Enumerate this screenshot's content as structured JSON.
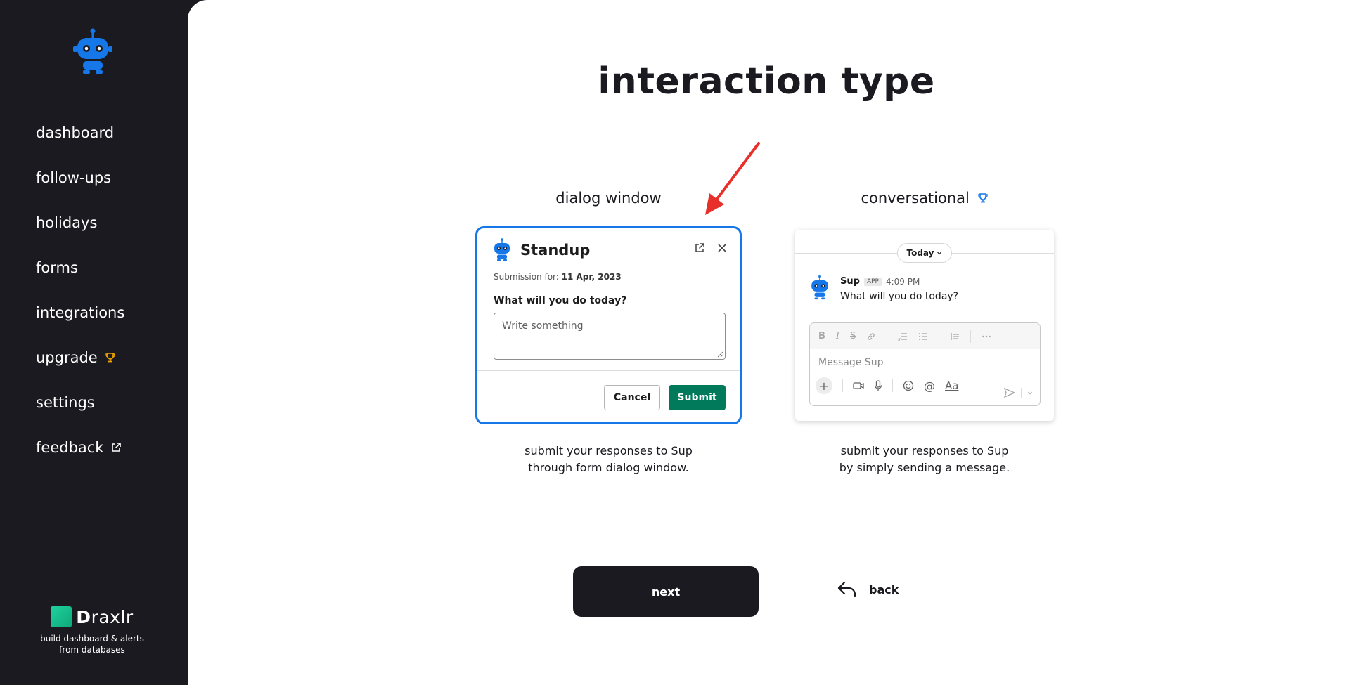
{
  "sidebar": {
    "items": [
      {
        "label": "dashboard"
      },
      {
        "label": "follow-ups"
      },
      {
        "label": "holidays"
      },
      {
        "label": "forms"
      },
      {
        "label": "integrations"
      },
      {
        "label": "upgrade"
      },
      {
        "label": "settings"
      },
      {
        "label": "feedback"
      }
    ],
    "brand": {
      "name_initial": "D",
      "name_rest": "raxlr",
      "tagline_line1": "build dashboard & alerts",
      "tagline_line2": "from databases"
    }
  },
  "main": {
    "title": "interaction type",
    "options": {
      "dialog": {
        "label": "dialog window",
        "desc_line1": "submit your responses to Sup",
        "desc_line2": "through form dialog window.",
        "preview": {
          "title": "Standup",
          "submission_prefix": "Submission for:",
          "submission_date": "11 Apr, 2023",
          "question": "What will you do today?",
          "placeholder": "Write something",
          "cancel_label": "Cancel",
          "submit_label": "Submit"
        }
      },
      "conversational": {
        "label": "conversational",
        "desc_line1": "submit your responses to Sup",
        "desc_line2": "by simply sending a message.",
        "preview": {
          "day_pill": "Today",
          "bot_name": "Sup",
          "app_badge": "APP",
          "time": "4:09 PM",
          "message": "What will you do today?",
          "composer_placeholder": "Message Sup",
          "format_text": "Aa"
        }
      }
    },
    "next_label": "next",
    "back_label": "back"
  },
  "colors": {
    "sidebar_bg": "#1b1a20",
    "accent_blue": "#1577e8",
    "trophy_gold": "#f2a500",
    "submit_green": "#007a5a",
    "annotation_red": "#e8302a"
  }
}
